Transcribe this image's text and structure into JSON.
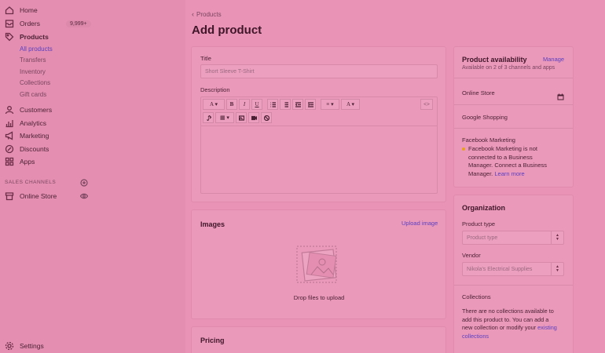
{
  "sidebar": {
    "items": [
      {
        "label": "Home",
        "icon": "home-icon"
      },
      {
        "label": "Orders",
        "icon": "orders-icon",
        "badge": "9,999+"
      },
      {
        "label": "Products",
        "icon": "tag-icon"
      },
      {
        "label": "Customers",
        "icon": "customers-icon"
      },
      {
        "label": "Analytics",
        "icon": "analytics-icon"
      },
      {
        "label": "Marketing",
        "icon": "megaphone-icon"
      },
      {
        "label": "Discounts",
        "icon": "discount-icon"
      },
      {
        "label": "Apps",
        "icon": "apps-icon"
      }
    ],
    "product_subitems": [
      "All products",
      "Transfers",
      "Inventory",
      "Collections",
      "Gift cards"
    ],
    "sales_channels_label": "SALES CHANNELS",
    "online_store": "Online Store",
    "settings": "Settings"
  },
  "header": {
    "breadcrumb": "Products",
    "title": "Add product"
  },
  "main": {
    "title_label": "Title",
    "title_placeholder": "Short Sleeve T-Shirt",
    "description_label": "Description",
    "images_title": "Images",
    "upload_link": "Upload image",
    "drop_text": "Drop files to upload",
    "pricing_title": "Pricing"
  },
  "availability": {
    "title": "Product availability",
    "manage": "Manage",
    "subtitle": "Available on 2 of 3 channels and apps",
    "online_store": "Online Store",
    "google_shopping": "Google Shopping",
    "facebook_title": "Facebook Marketing",
    "facebook_msg_1": "Facebook Marketing is not",
    "facebook_msg_2": "connected to a Business",
    "facebook_msg_3": "Manager. Connect a Business",
    "facebook_msg_4": "Manager.",
    "learn_more": "Learn more"
  },
  "organization": {
    "title": "Organization",
    "product_type_label": "Product type",
    "product_type_placeholder": "Product type",
    "vendor_label": "Vendor",
    "vendor_value": "Nikola's Electrical Supplies",
    "collections_label": "Collections",
    "collections_msg_1": "There are no collections available to",
    "collections_msg_2": "add this product to. You can add a",
    "collections_msg_3": "new collection or modify your",
    "existing_link": "existing",
    "collections_link": "collections"
  },
  "colors": {
    "accent": "#5b3fc0",
    "background": "#e994b6",
    "warning_dot": "#e8a020"
  }
}
